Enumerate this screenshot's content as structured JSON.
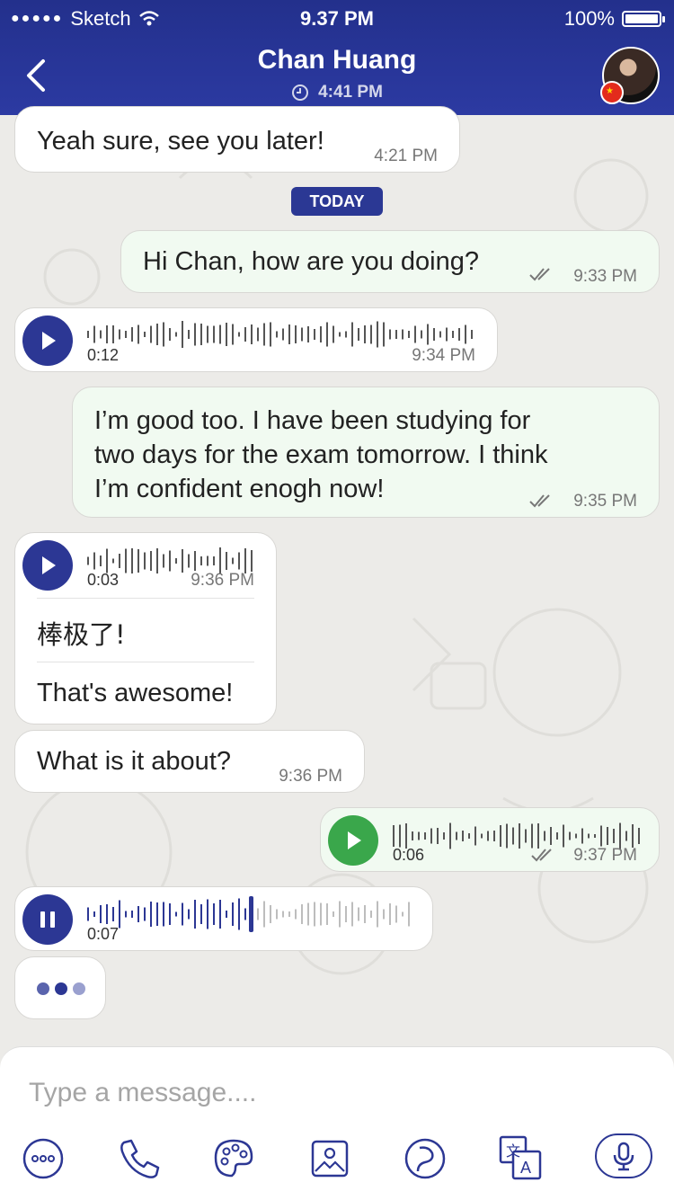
{
  "status_bar": {
    "carrier": "Sketch",
    "time": "9.37 PM",
    "battery": "100%"
  },
  "header": {
    "title": "Chan Huang",
    "subtitle": "4:41 PM",
    "icons": [
      "back-chevron-icon",
      "clock-icon",
      "avatar",
      "china-flag-icon"
    ]
  },
  "messages": [
    {
      "side": "in",
      "text": "Yeah sure, see you later!",
      "time": "4:21 PM"
    },
    {
      "side": "divider",
      "text": "TODAY"
    },
    {
      "side": "out",
      "text": "Hi Chan, how are you doing?",
      "time": "9:33 PM"
    },
    {
      "side": "in",
      "type": "voice",
      "duration": "0:12",
      "time": "9:34 PM"
    },
    {
      "side": "out",
      "lines": [
        "I’m good too. I have been studying for",
        "two days for the exam tomorrow. I think",
        "I’m confident enogh now!"
      ],
      "time": "9:35 PM"
    },
    {
      "side": "in",
      "type": "voice-translated",
      "duration": "0:03",
      "time": "9:36 PM",
      "transcript": "棒极了!",
      "translation": "That's awesome!"
    },
    {
      "side": "in",
      "text": "What is it about?",
      "time": "9:36 PM"
    },
    {
      "side": "out",
      "type": "voice",
      "duration": "0:06",
      "time": "9:37 PM"
    },
    {
      "side": "in",
      "type": "voice-playing",
      "duration": "0:07",
      "progress": 0.5
    }
  ],
  "composer": {
    "placeholder": "Type a message....",
    "tools": [
      "more-icon",
      "phone-icon",
      "palette-icon",
      "image-icon",
      "sticker-icon",
      "translate-icon",
      "microphone-icon"
    ]
  },
  "colors": {
    "header": "#23308c",
    "accent": "#2c3794",
    "outgoing_bubble": "#f1faf1",
    "green_play": "#3aa74b"
  }
}
